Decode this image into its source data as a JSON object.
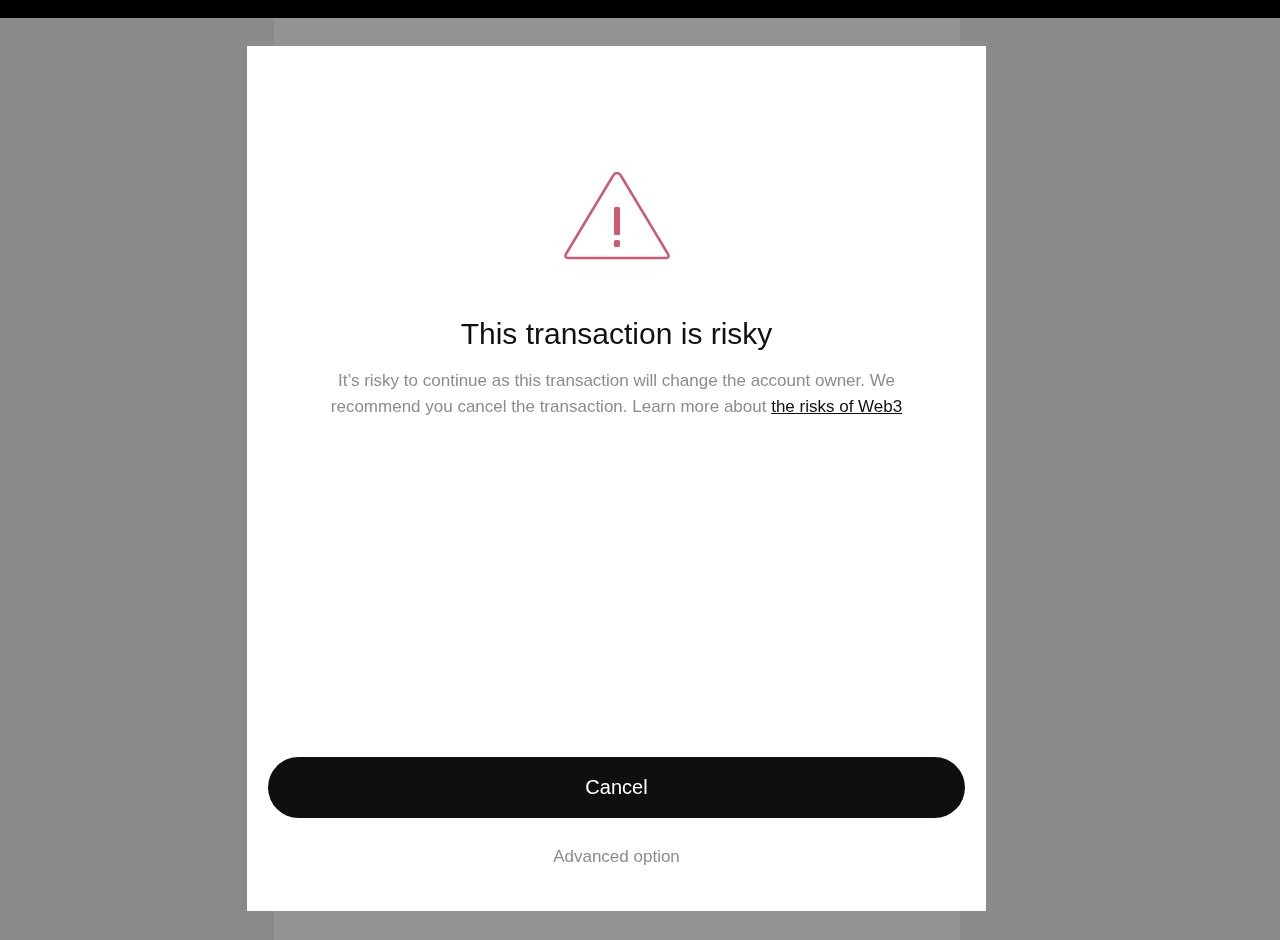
{
  "dialog": {
    "title": "This transaction is risky",
    "message": "It’s risky to continue as this transaction will change the account owner. We recommend you cancel the transaction. Learn more about ",
    "link": "the risks of Web3",
    "primary_button": "Cancel",
    "secondary_link": "Advanced option"
  }
}
